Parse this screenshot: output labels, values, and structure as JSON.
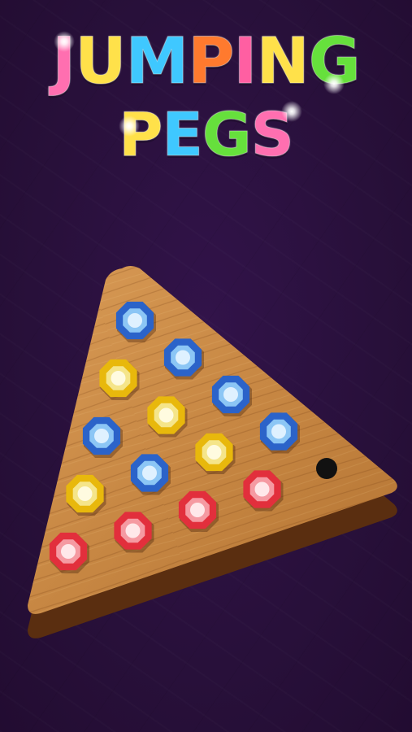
{
  "title": {
    "line1": "JUMPING",
    "line2": "PEGS",
    "line1_colors": [
      "#ff6fb0",
      "#ffe14a",
      "#3fc8ff",
      "#ff7a2e",
      "#ff5fa2",
      "#ffe14a",
      "#66e03c"
    ],
    "line2_colors": [
      "#ffe14a",
      "#3fc8ff",
      "#66e03c",
      "#ff6fb0"
    ]
  },
  "colors": {
    "background": "#2a0f3c",
    "board_wood": "#c98a45",
    "board_shadow": "#5a2e10",
    "peg_blue": "#2f6fd6",
    "peg_yellow": "#f1c40f",
    "peg_red": "#e8333f",
    "empty_hole": "#111111"
  },
  "board": {
    "rows": [
      [
        "blue"
      ],
      [
        "yellow",
        "blue"
      ],
      [
        "blue",
        "yellow",
        "blue"
      ],
      [
        "yellow",
        "blue",
        "yellow",
        "blue"
      ],
      [
        "red",
        "red",
        "red",
        "red",
        "empty"
      ]
    ]
  }
}
